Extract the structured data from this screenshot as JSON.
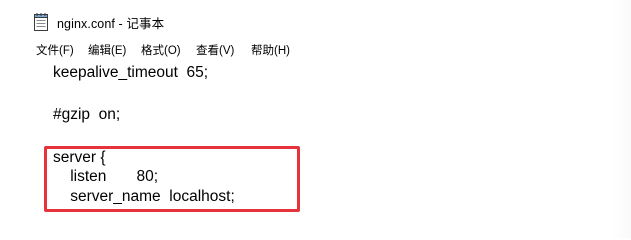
{
  "window": {
    "title": "nginx.conf - 记事本",
    "icon": "notepad-icon"
  },
  "menu": {
    "items": [
      {
        "label": "文件(F)"
      },
      {
        "label": "编辑(E)"
      },
      {
        "label": "格式(O)"
      },
      {
        "label": "查看(V)"
      },
      {
        "label": "帮助(H)"
      }
    ]
  },
  "editor": {
    "lines": [
      {
        "text": "keepalive_timeout  65;"
      },
      {
        "text": "#gzip  on;"
      },
      {
        "text": "server {"
      },
      {
        "text": "    listen       80;"
      },
      {
        "text": "    server_name  localhost;"
      }
    ],
    "highlight_color": "#e5323b"
  }
}
